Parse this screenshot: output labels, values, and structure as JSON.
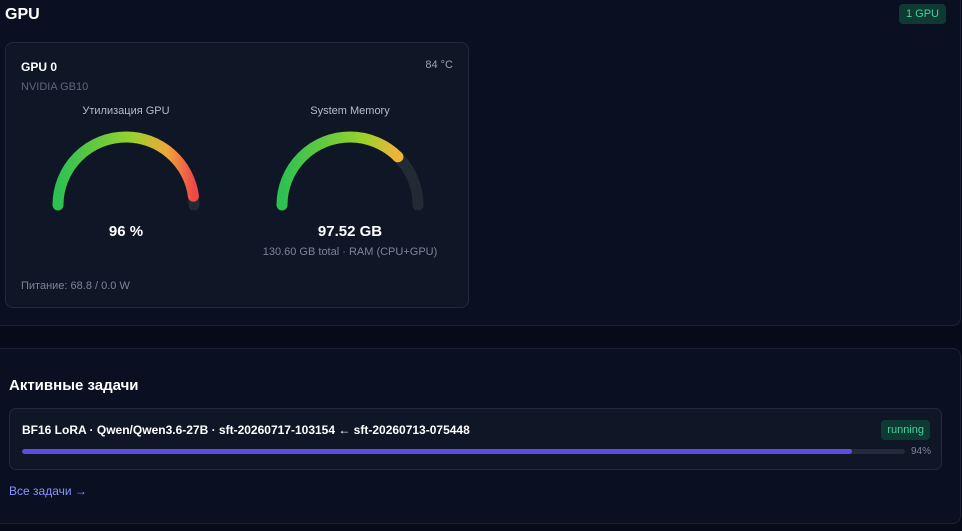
{
  "gpu_section": {
    "title": "GPU",
    "count_badge": "1 GPU",
    "card": {
      "name": "GPU 0",
      "model": "NVIDIA GB10",
      "temperature": "84 °C",
      "utilization": {
        "label": "Утилизация GPU",
        "value_text": "96 %",
        "fraction": 0.96
      },
      "memory": {
        "label": "System Memory",
        "value_text": "97.52 GB",
        "sub_text": "130.60 GB total · RAM (CPU+GPU)",
        "fraction": 0.75
      },
      "power": "Питание: 68.8 / 0.0 W"
    },
    "colors": {
      "badge_bg": "#0e3a33",
      "badge_text": "#43d29a",
      "gauge_track": "#222a36",
      "gauge_green": "#2cc152",
      "gauge_yellow": "#f0c23b",
      "gauge_red": "#ee4747"
    }
  },
  "tasks_section": {
    "title": "Активные задачи",
    "tasks": [
      {
        "name": "BF16 LoRA · Qwen/Qwen3.6-27B · sft-20260717-103154 ← sft-20260713-075448",
        "status": "running",
        "progress_text": "94%",
        "progress_fraction": 0.94
      }
    ],
    "all_link": "Все задачи →",
    "colors": {
      "progress": "#5b4fe0",
      "link": "#8b93ff"
    }
  }
}
